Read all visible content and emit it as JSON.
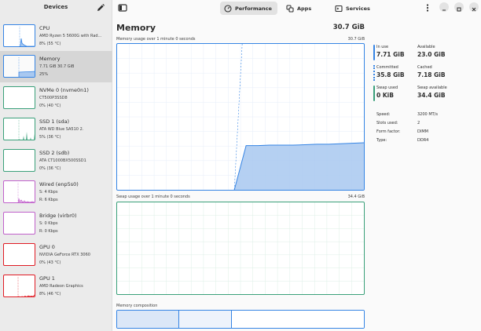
{
  "sidebar": {
    "title": "Devices",
    "devices": [
      {
        "name": "CPU",
        "line1": "AMD Ryzen 5 5600G with Rad...",
        "line2": "8% (55 °C)",
        "color": "#3584e4",
        "kind": "cpu"
      },
      {
        "name": "Memory",
        "line1": "7.71 GiB 30.7 GiB",
        "line2": "25%",
        "color": "#3584e4",
        "kind": "memory"
      },
      {
        "name": "NVMe 0 (nvme0n1)",
        "line1": "CT500P3SSD8",
        "line2": "0% (40 °C)",
        "color": "#3aa07a",
        "kind": "flat"
      },
      {
        "name": "SSD 1 (sda)",
        "line1": "ATA WD Blue SA510 2.",
        "line2": "5% (36 °C)",
        "color": "#3aa07a",
        "kind": "ssd1"
      },
      {
        "name": "SSD 2 (sdb)",
        "line1": "ATA CT1000BX500SSD1",
        "line2": "0% (36 °C)",
        "color": "#3aa07a",
        "kind": "flat"
      },
      {
        "name": "Wired (enp5s0)",
        "line1": "S: 4 Kbps",
        "line2": "R: 6 Kbps",
        "color": "#c061cb",
        "kind": "wired"
      },
      {
        "name": "Bridge (virbr0)",
        "line1": "S: 0 Kbps",
        "line2": "R: 0 Kbps",
        "color": "#c061cb",
        "kind": "flat"
      },
      {
        "name": "GPU 0",
        "line1": "NVIDIA GeForce RTX 3060",
        "line2": "0% (43 °C)",
        "color": "#e01b24",
        "kind": "flat"
      },
      {
        "name": "GPU 1",
        "line1": "AMD Radeon Graphics",
        "line2": "8% (46 °C)",
        "color": "#e01b24",
        "kind": "gpu1"
      }
    ]
  },
  "tabs": [
    {
      "label": "Performance",
      "icon": "gauge-icon",
      "active": true
    },
    {
      "label": "Apps",
      "icon": "apps-icon",
      "active": false
    },
    {
      "label": "Services",
      "icon": "services-icon",
      "active": false
    }
  ],
  "main": {
    "title": "Memory",
    "total": "30.7 GiB",
    "memory_graph": {
      "label": "Memory usage over 1 minute 0 seconds",
      "max": "30.7 GiB"
    },
    "swap_graph": {
      "label": "Swap usage over 1 minute 0 seconds",
      "max": "34.4 GiB"
    },
    "composition": {
      "label": "Memory composition",
      "segments": [
        0.25,
        0.215
      ]
    }
  },
  "chart_data": {
    "type": "area",
    "title": "Memory usage over 1 minute 0 seconds",
    "ylim": [
      0,
      30.7
    ],
    "unit": "GiB",
    "start_fraction": 0.475,
    "series": [
      {
        "values": [
          0,
          9.3,
          9.3,
          9.4,
          9.4,
          9.4,
          9.5,
          9.6,
          9.6,
          9.7,
          9.8,
          9.9
        ]
      }
    ],
    "grid": true
  },
  "stats": {
    "in_use": {
      "label": "In use",
      "value": "7.71 GiB"
    },
    "available": {
      "label": "Available",
      "value": "23.0 GiB"
    },
    "committed": {
      "label": "Committed",
      "value": "35.8 GiB"
    },
    "cached": {
      "label": "Cached",
      "value": "7.18 GiB"
    },
    "swap_used": {
      "label": "Swap used",
      "value": "0 KiB"
    },
    "swap_available": {
      "label": "Swap available",
      "value": "34.4 GiB"
    }
  },
  "info": [
    {
      "key": "Speed:",
      "value": "3200 MT/s"
    },
    {
      "key": "Slots used:",
      "value": "2"
    },
    {
      "key": "Form factor:",
      "value": "DIMM"
    },
    {
      "key": "Type:",
      "value": "DDR4"
    }
  ],
  "colors": {
    "accent": "#3584e4",
    "swap": "#3aa07a",
    "network": "#c061cb",
    "gpu": "#e01b24"
  }
}
